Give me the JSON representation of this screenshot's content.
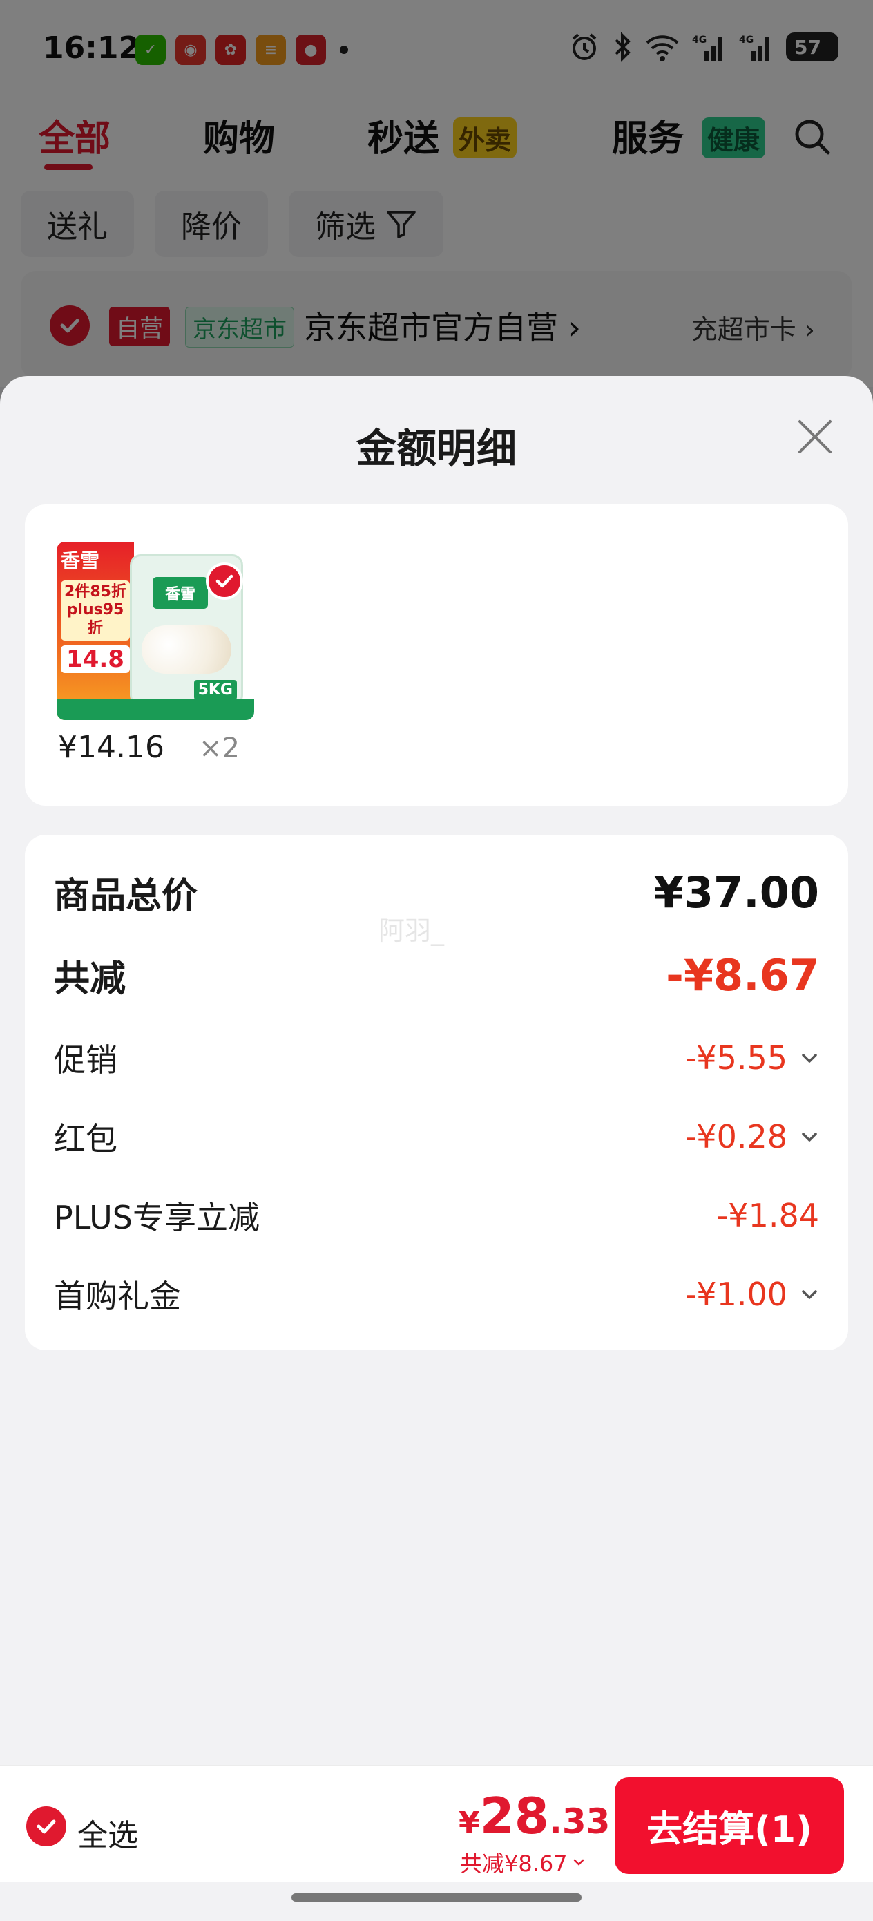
{
  "status_bar": {
    "time": "16:12",
    "app_icons": [
      "wechat-icon",
      "jd-icon",
      "app-red-icon",
      "app-orange-icon",
      "app-red2-icon"
    ],
    "battery": "57"
  },
  "tabs": [
    {
      "label": "全部",
      "active": true
    },
    {
      "label": "购物"
    },
    {
      "label": "秒送",
      "badge": "外卖"
    },
    {
      "label": "服务",
      "badge": "健康"
    }
  ],
  "filters": [
    {
      "label": "送礼"
    },
    {
      "label": "降价"
    },
    {
      "label": "筛选"
    }
  ],
  "store": {
    "badge_self": "自营",
    "badge_market": "京东超市",
    "name": "京东超市官方自营 ›",
    "card_link": "充超市卡 ›"
  },
  "sheet": {
    "title": "金额明细"
  },
  "product": {
    "thumb_brand": "香雪",
    "thumb_promo": "2件85折 plus95折",
    "thumb_price": "14.8",
    "thumb_bag_brand": "香雪",
    "thumb_bag_weight": "5KG",
    "price": "¥14.16",
    "quantity": "×2"
  },
  "details": {
    "total_label": "商品总价",
    "total_value": "¥37.00",
    "discount_label": "共减",
    "discount_value": "-¥8.67",
    "items": [
      {
        "label": "促销",
        "value": "-¥5.55",
        "expandable": true
      },
      {
        "label": "红包",
        "value": "-¥0.28",
        "expandable": true
      },
      {
        "label": "PLUS专享立减",
        "value": "-¥1.84",
        "expandable": false
      },
      {
        "label": "首购礼金",
        "value": "-¥1.00",
        "expandable": true
      }
    ]
  },
  "watermark": "阿羽_",
  "checkout": {
    "select_all": "全选",
    "currency": "¥",
    "amount_int": "28",
    "amount_dec": ".33",
    "saved": "共减¥8.67",
    "button": "去结算(1)"
  },
  "colors": {
    "accent": "#e0192f",
    "discount": "#e8361f",
    "button": "#f2102e"
  }
}
